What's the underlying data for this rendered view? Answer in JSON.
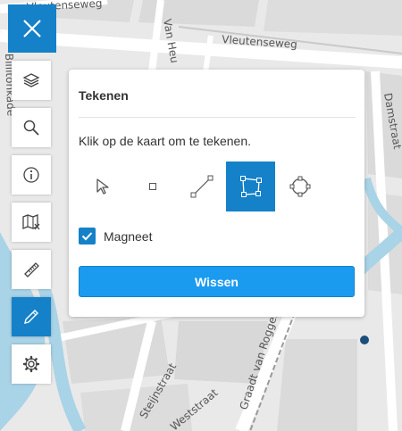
{
  "map": {
    "street_labels": [
      "Vleutenseweg",
      "Vleutenseweg",
      "Van Heu",
      "Billitonkade",
      "Damstraat",
      "Steijnstraat",
      "Weststraat",
      "Graadt van Roggenstr."
    ],
    "marker_color": "#1a4f7a"
  },
  "toolbar": {
    "close_icon": "close-icon",
    "tools": [
      {
        "icon": "layers-icon",
        "active": false
      },
      {
        "icon": "search-icon",
        "active": false
      },
      {
        "icon": "info-icon",
        "active": false
      },
      {
        "icon": "map-book-icon",
        "active": false
      },
      {
        "icon": "ruler-icon",
        "active": false
      },
      {
        "icon": "pencil-icon",
        "active": true
      },
      {
        "icon": "settings-icon",
        "active": false
      }
    ]
  },
  "draw_panel": {
    "title": "Tekenen",
    "instruction": "Klik op de kaart om te tekenen.",
    "shape_tools": [
      {
        "icon": "cursor-icon",
        "active": false
      },
      {
        "icon": "point-icon",
        "active": false
      },
      {
        "icon": "line-icon",
        "active": false
      },
      {
        "icon": "polygon-icon",
        "active": true
      },
      {
        "icon": "circle-icon",
        "active": false
      }
    ],
    "snap_label": "Magneet",
    "snap_checked": true,
    "clear_label": "Wissen"
  },
  "colors": {
    "accent": "#1581c8",
    "button": "#1b9bf0"
  }
}
